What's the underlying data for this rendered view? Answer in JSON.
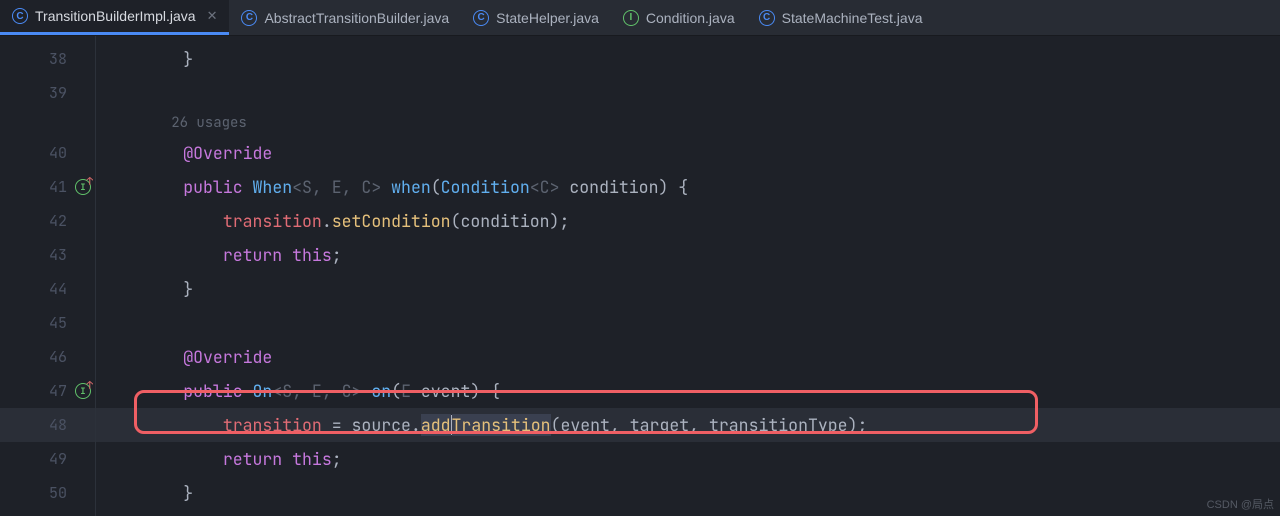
{
  "tabs": [
    {
      "icon": "C",
      "label": "TransitionBuilderImpl.java",
      "active": true,
      "closeable": true
    },
    {
      "icon": "C",
      "label": "AbstractTransitionBuilder.java",
      "active": false
    },
    {
      "icon": "C",
      "label": "StateHelper.java",
      "active": false
    },
    {
      "icon": "I",
      "label": "Condition.java",
      "active": false
    },
    {
      "icon": "C",
      "label": "StateMachineTest.java",
      "active": false
    }
  ],
  "gutter": {
    "lines": [
      "38",
      "39",
      "",
      "40",
      "41",
      "42",
      "43",
      "44",
      "45",
      "46",
      "47",
      "48",
      "49",
      "50"
    ],
    "overrideIcons": {
      "4": "I",
      "10": "I"
    }
  },
  "code": {
    "l0": "        }",
    "usages": "26 usages",
    "override1": "@Override",
    "kw_public": "public",
    "type_When": "When",
    "gen_SEC": "<S, E, C>",
    "meth_when": "when",
    "type_Condition": "Condition",
    "gen_C": "<C>",
    "param_condition": "condition",
    "field_transition": "transition",
    "meth_setCondition": "setCondition",
    "kw_return": "return",
    "kw_this": "this",
    "brace_close": "}",
    "override2": "@Override",
    "type_On": "On",
    "meth_on": "on",
    "type_E": "E",
    "param_event": "event",
    "var_source": "source",
    "meth_addTransition": "addTransition",
    "var_target": "target",
    "var_transitionType": "transitionType"
  },
  "watermark": "CSDN @局点"
}
